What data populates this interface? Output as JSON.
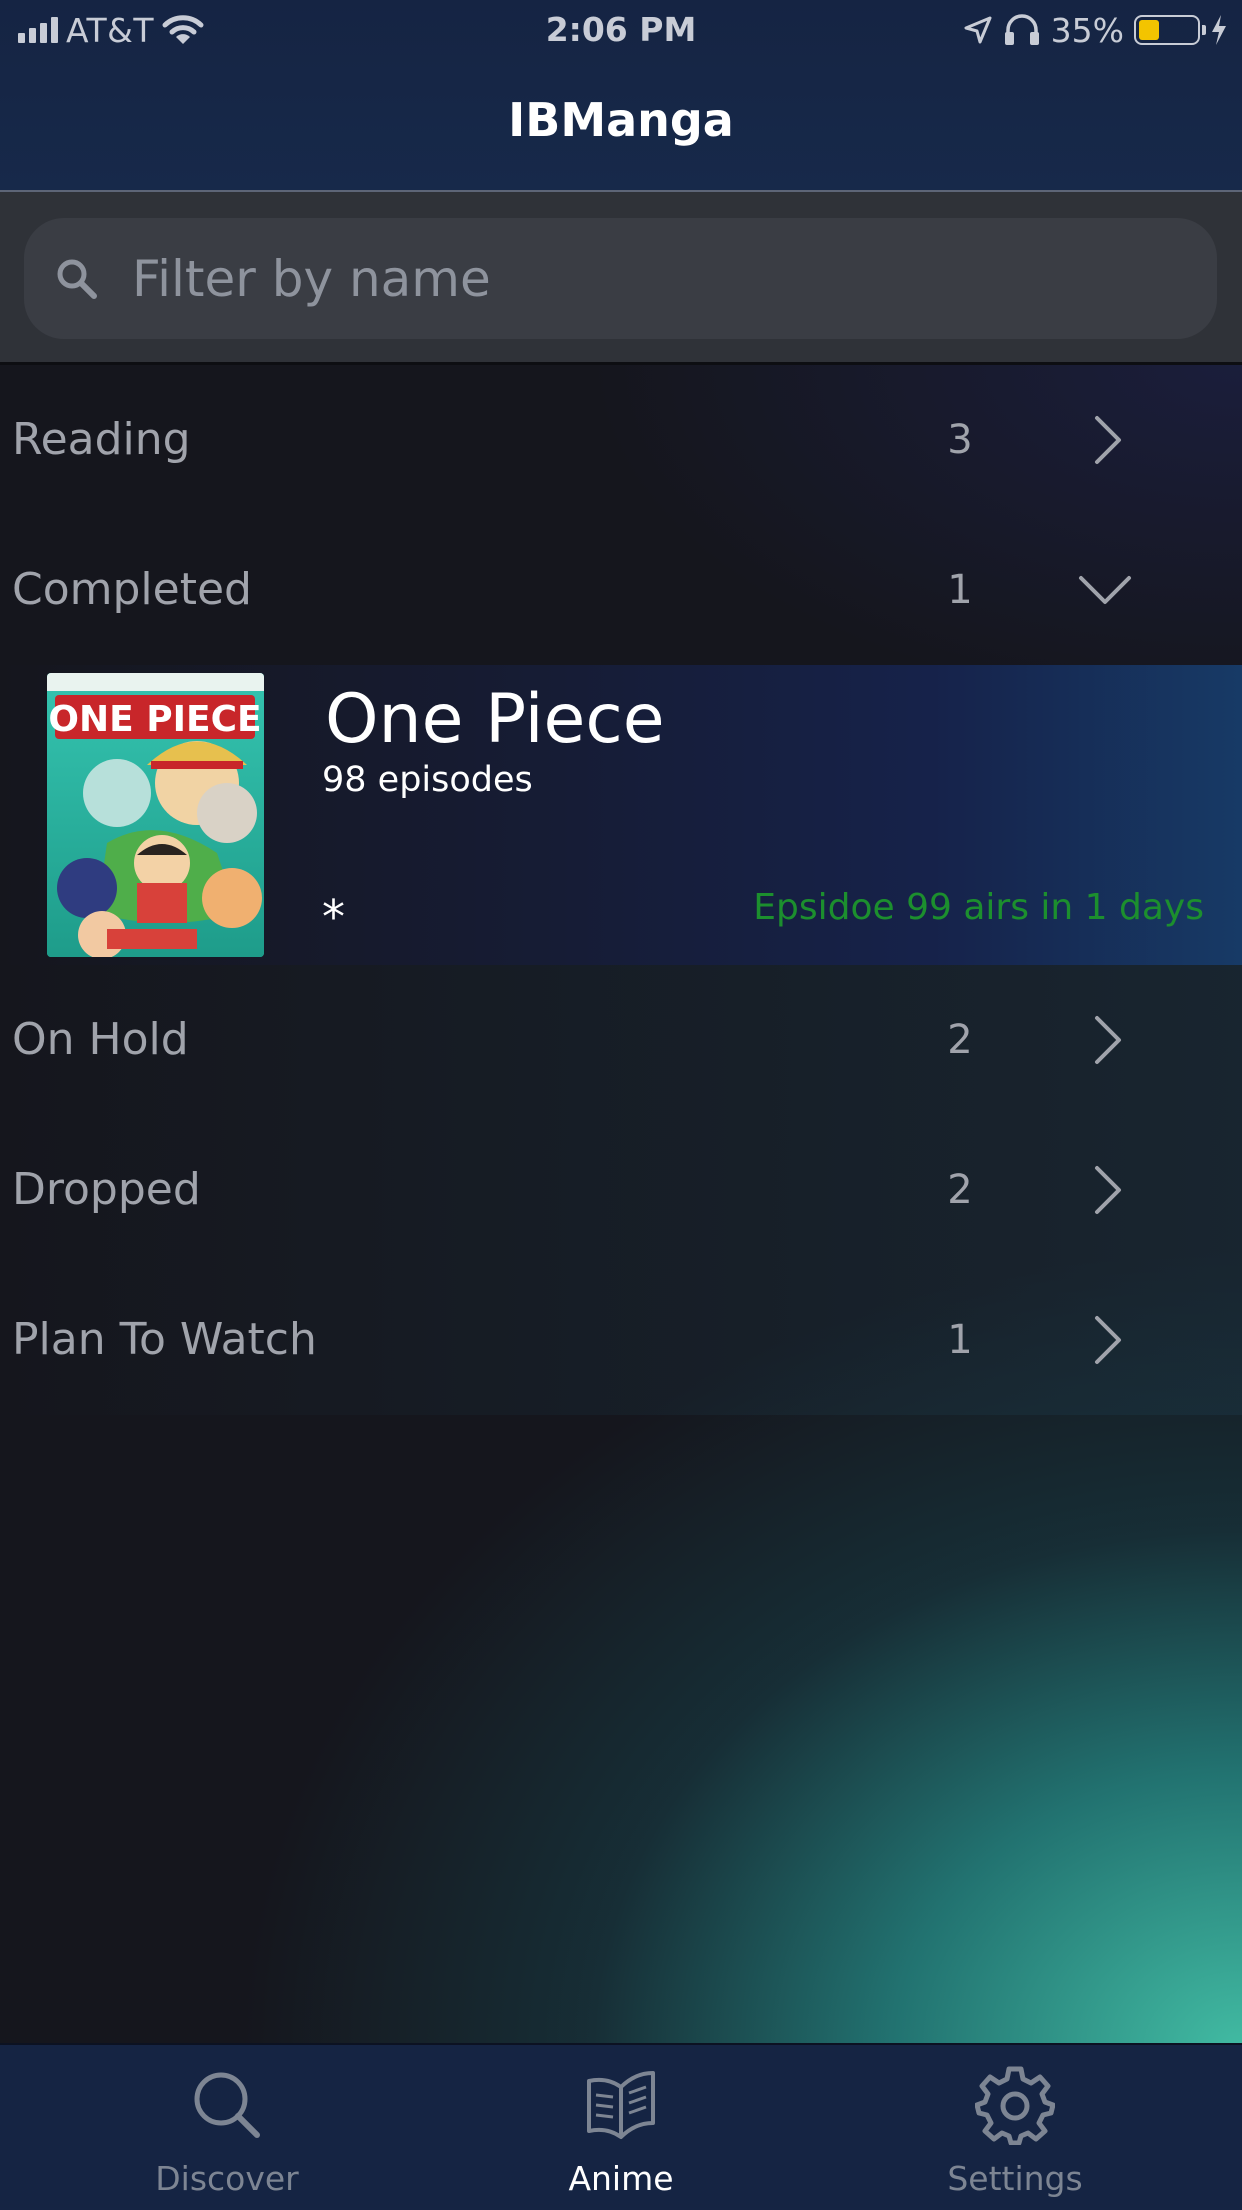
{
  "status_bar": {
    "carrier": "AT&T",
    "time": "2:06 PM",
    "battery_percent": "35%",
    "battery_level": 0.35
  },
  "nav": {
    "title": "IBManga"
  },
  "search": {
    "placeholder": "Filter by name",
    "value": ""
  },
  "categories": [
    {
      "label": "Reading",
      "count": "3",
      "expanded": false
    },
    {
      "label": "Completed",
      "count": "1",
      "expanded": true
    },
    {
      "label": "On Hold",
      "count": "2",
      "expanded": false
    },
    {
      "label": "Dropped",
      "count": "2",
      "expanded": false
    },
    {
      "label": "Plan To Watch",
      "count": "1",
      "expanded": false
    }
  ],
  "completed_items": [
    {
      "title": "One Piece",
      "episodes": "98 episodes",
      "mark": "*",
      "airing": "Epsidoe 99 airs in 1 days",
      "cover_text": "ONE PIECE",
      "cover_icon": "anime-cover-image"
    }
  ],
  "tabs": [
    {
      "label": "Discover",
      "icon": "magnifier-icon",
      "active": false
    },
    {
      "label": "Anime",
      "icon": "open-book-icon",
      "active": true
    },
    {
      "label": "Settings",
      "icon": "gear-icon",
      "active": false
    }
  ],
  "colors": {
    "nav_background": "#152443",
    "airing_text": "#1c8f2e",
    "accent_gradient_end": "#44c4aa",
    "battery_fill": "#f3c400"
  }
}
